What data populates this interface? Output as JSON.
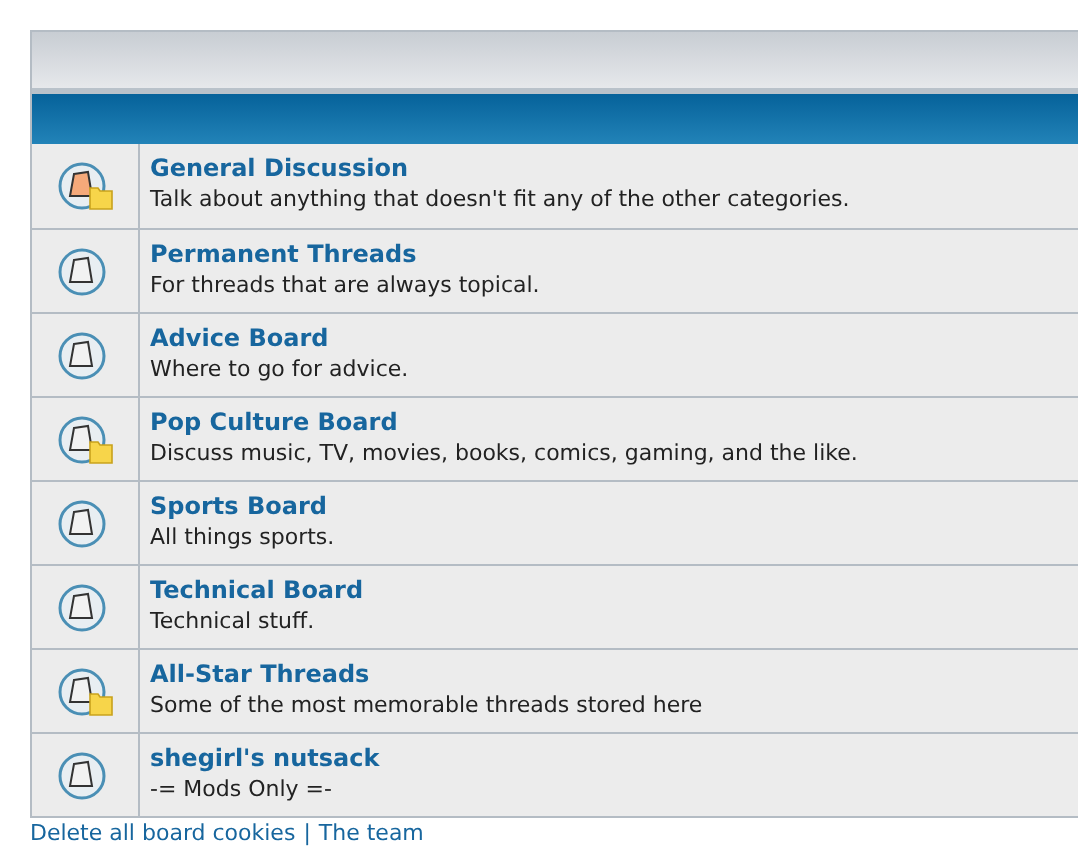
{
  "forums": [
    {
      "title": "General Discussion",
      "description": "Talk about anything that doesn't fit any of the other categories.",
      "unread": true,
      "subforums": true
    },
    {
      "title": "Permanent Threads",
      "description": "For threads that are always topical.",
      "unread": false,
      "subforums": false
    },
    {
      "title": "Advice Board",
      "description": "Where to go for advice.",
      "unread": false,
      "subforums": false
    },
    {
      "title": "Pop Culture Board",
      "description": "Discuss music, TV, movies, books, comics, gaming, and the like.",
      "unread": false,
      "subforums": true
    },
    {
      "title": "Sports Board",
      "description": "All things sports.",
      "unread": false,
      "subforums": false
    },
    {
      "title": "Technical Board",
      "description": "Technical stuff.",
      "unread": false,
      "subforums": false
    },
    {
      "title": "All-Star Threads",
      "description": "Some of the most memorable threads stored here",
      "unread": false,
      "subforums": true
    },
    {
      "title": "shegirl's nutsack",
      "description": "-= Mods Only =-",
      "unread": false,
      "subforums": false
    }
  ],
  "footer_links": [
    "Delete all board cookies",
    "The team"
  ],
  "footer_separator": "|"
}
